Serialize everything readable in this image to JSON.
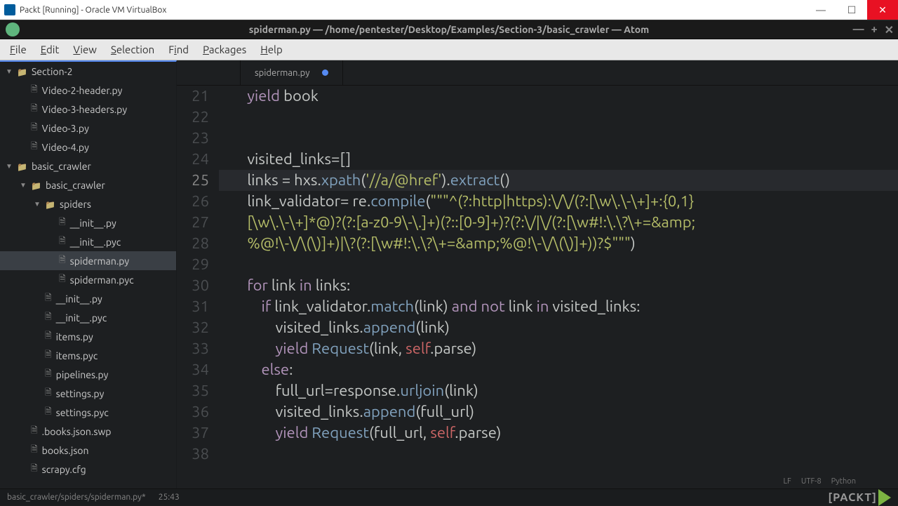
{
  "window": {
    "title": "Packt [Running] - Oracle VM VirtualBox"
  },
  "atom": {
    "title": "spiderman.py — /home/pentester/Desktop/Examples/Section-3/basic_crawler — Atom"
  },
  "menu": {
    "file": "File",
    "edit": "Edit",
    "view": "View",
    "selection": "Selection",
    "find": "Find",
    "packages": "Packages",
    "help": "Help"
  },
  "sidebar": {
    "root1": "Section-2",
    "files1": [
      "Video-2-header.py",
      "Video-3-headers.py",
      "Video-3.py",
      "Video-4.py"
    ],
    "root2": "basic_crawler",
    "sub2": "basic_crawler",
    "spiders": "spiders",
    "spider_files": [
      "__init__.py",
      "__init__.pyc",
      "spiderman.py",
      "spiderman.pyc"
    ],
    "crawler_files": [
      "__init__.py",
      "__init__.pyc",
      "items.py",
      "items.pyc",
      "pipelines.py",
      "settings.py",
      "settings.pyc"
    ],
    "root_files": [
      ".books.json.swp",
      "books.json",
      "scrapy.cfg"
    ]
  },
  "tab": {
    "name": "spiderman.py"
  },
  "code": {
    "lines": [
      {
        "num": "21",
        "indent": "        ",
        "tokens": [
          {
            "c": "kw",
            "t": "yield"
          },
          {
            "c": "id",
            "t": " book"
          }
        ]
      },
      {
        "num": "22",
        "indent": "",
        "tokens": []
      },
      {
        "num": "23",
        "indent": "",
        "tokens": []
      },
      {
        "num": "24",
        "indent": "        ",
        "tokens": [
          {
            "c": "id",
            "t": "visited_links"
          },
          {
            "c": "op",
            "t": "=[]"
          }
        ]
      },
      {
        "num": "25",
        "current": true,
        "indent": "        ",
        "tokens": [
          {
            "c": "id",
            "t": "links "
          },
          {
            "c": "op",
            "t": "= "
          },
          {
            "c": "id",
            "t": "hxs"
          },
          {
            "c": "op",
            "t": "."
          },
          {
            "c": "fn",
            "t": "xpath"
          },
          {
            "c": "op",
            "t": "("
          },
          {
            "c": "str",
            "t": "'//a/@href'"
          },
          {
            "c": "op",
            "t": ")."
          },
          {
            "c": "fn",
            "t": "extract"
          },
          {
            "c": "op",
            "t": "()"
          }
        ]
      },
      {
        "num": "26",
        "indent": "        ",
        "tokens": [
          {
            "c": "id",
            "t": "link_validator"
          },
          {
            "c": "op",
            "t": "= "
          },
          {
            "c": "id",
            "t": "re"
          },
          {
            "c": "op",
            "t": "."
          },
          {
            "c": "fn",
            "t": "compile"
          },
          {
            "c": "op",
            "t": "("
          },
          {
            "c": "str",
            "t": "\"\"\"^(?:http|https):\\/\\/(?:[\\w\\.\\-\\+]+:{0,1}"
          }
        ]
      },
      {
        "num": "27",
        "indent": "        ",
        "tokens": [
          {
            "c": "str",
            "t": "[\\w\\.\\-\\+]*@)?(?:[a-z0-9\\-\\.]+)(?::[0-9]+)?(?:\\/|\\/(?:[\\w#!:\\.\\?\\+=&amp;"
          }
        ]
      },
      {
        "num": "28",
        "indent": "        ",
        "tokens": [
          {
            "c": "str",
            "t": "%@!\\-\\/\\(\\)]+)|\\?(?:[\\w#!:\\.\\?\\+=&amp;%@!\\-\\/\\(\\)]+))?$\"\"\""
          },
          {
            "c": "op",
            "t": ")"
          }
        ]
      },
      {
        "num": "29",
        "indent": "",
        "tokens": []
      },
      {
        "num": "30",
        "indent": "        ",
        "tokens": [
          {
            "c": "kw",
            "t": "for"
          },
          {
            "c": "id",
            "t": " link "
          },
          {
            "c": "kw",
            "t": "in"
          },
          {
            "c": "id",
            "t": " links"
          },
          {
            "c": "op",
            "t": ":"
          }
        ]
      },
      {
        "num": "31",
        "indent": "            ",
        "tokens": [
          {
            "c": "kw",
            "t": "if"
          },
          {
            "c": "id",
            "t": " link_validator"
          },
          {
            "c": "op",
            "t": "."
          },
          {
            "c": "fn",
            "t": "match"
          },
          {
            "c": "op",
            "t": "(link) "
          },
          {
            "c": "kw",
            "t": "and not"
          },
          {
            "c": "id",
            "t": " link "
          },
          {
            "c": "kw",
            "t": "in"
          },
          {
            "c": "id",
            "t": " visited_links"
          },
          {
            "c": "op",
            "t": ":"
          }
        ]
      },
      {
        "num": "32",
        "indent": "                ",
        "tokens": [
          {
            "c": "id",
            "t": "visited_links"
          },
          {
            "c": "op",
            "t": "."
          },
          {
            "c": "fn",
            "t": "append"
          },
          {
            "c": "op",
            "t": "(link)"
          }
        ]
      },
      {
        "num": "33",
        "indent": "                ",
        "tokens": [
          {
            "c": "kw",
            "t": "yield"
          },
          {
            "c": "id",
            "t": " "
          },
          {
            "c": "fn",
            "t": "Request"
          },
          {
            "c": "op",
            "t": "(link, "
          },
          {
            "c": "self",
            "t": "self"
          },
          {
            "c": "op",
            "t": ".parse)"
          }
        ]
      },
      {
        "num": "34",
        "indent": "            ",
        "tokens": [
          {
            "c": "kw",
            "t": "else"
          },
          {
            "c": "op",
            "t": ":"
          }
        ]
      },
      {
        "num": "35",
        "indent": "                ",
        "tokens": [
          {
            "c": "id",
            "t": "full_url"
          },
          {
            "c": "op",
            "t": "="
          },
          {
            "c": "id",
            "t": "response"
          },
          {
            "c": "op",
            "t": "."
          },
          {
            "c": "fn",
            "t": "urljoin"
          },
          {
            "c": "op",
            "t": "(link)"
          }
        ]
      },
      {
        "num": "36",
        "indent": "                ",
        "tokens": [
          {
            "c": "id",
            "t": "visited_links"
          },
          {
            "c": "op",
            "t": "."
          },
          {
            "c": "fn",
            "t": "append"
          },
          {
            "c": "op",
            "t": "(full_url)"
          }
        ]
      },
      {
        "num": "37",
        "indent": "                ",
        "tokens": [
          {
            "c": "kw",
            "t": "yield"
          },
          {
            "c": "id",
            "t": " "
          },
          {
            "c": "fn",
            "t": "Request"
          },
          {
            "c": "op",
            "t": "(full_url, "
          },
          {
            "c": "self",
            "t": "self"
          },
          {
            "c": "op",
            "t": ".parse)"
          }
        ]
      },
      {
        "num": "38",
        "indent": "",
        "tokens": []
      }
    ]
  },
  "status": {
    "path": "basic_crawler/spiders/spiderman.py*",
    "pos": "25:43",
    "lf": "LF",
    "enc": "UTF-8",
    "lang": "Python",
    "logo": "PACKT"
  }
}
